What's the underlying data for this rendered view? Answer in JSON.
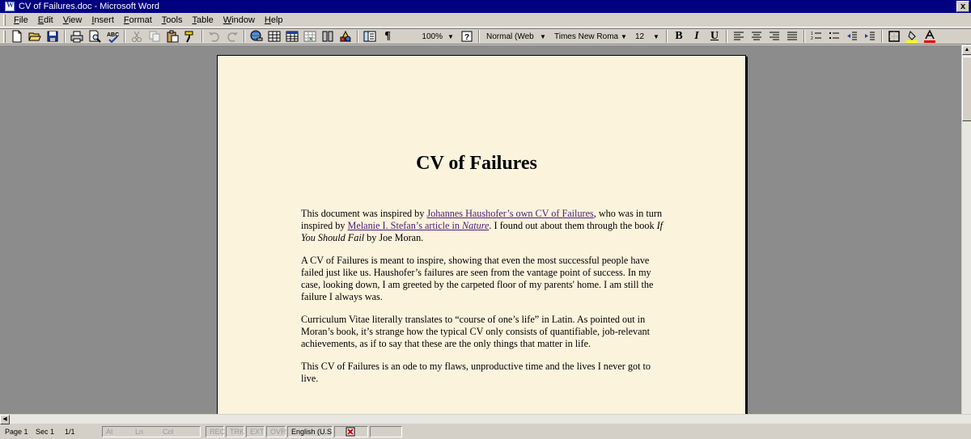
{
  "window": {
    "title": "CV of Failures.doc - Microsoft Word",
    "close_glyph": "x"
  },
  "menu": [
    {
      "ul": "F",
      "rest": "ile"
    },
    {
      "ul": "E",
      "rest": "dit"
    },
    {
      "ul": "V",
      "rest": "iew"
    },
    {
      "ul": "I",
      "rest": "nsert"
    },
    {
      "ul": "F",
      "rest": "ormat"
    },
    {
      "ul": "T",
      "rest": "ools"
    },
    {
      "ul": "T",
      "rest": "able"
    },
    {
      "ul": "W",
      "rest": "indow"
    },
    {
      "ul": "H",
      "rest": "elp"
    }
  ],
  "toolbar": {
    "zoom": "100%",
    "style": "Normal (Web",
    "font": "Times New Roma",
    "size": "12",
    "bold": "B",
    "italic": "I",
    "underline": "U",
    "pilcrow": "¶",
    "help": "?",
    "font_color": "#e00000",
    "highlight_color": "#ffff00"
  },
  "document": {
    "title": "CV of Failures",
    "p1": {
      "t1": "This document was inspired by ",
      "link1": "Johannes Haushofer’s own CV of Failures",
      "t2": ", who was in turn inspired by ",
      "link2a": "Melanie I. Stefan’s article in ",
      "link2b": "Nature",
      "t3": ". I found out about them through the book ",
      "book": "If You Should Fail",
      "t4": " by Joe Moran."
    },
    "p2": "A CV of Failures is meant to inspire, showing that even the most successful people have failed just like us. Haushofer’s failures are seen from the vantage point of success. In my case, looking down, I am greeted by the carpeted floor of my parents' home. I am still the failure I always was.",
    "p3": "Curriculum Vitae literally translates to “course of one’s life” in Latin. As pointed out in Moran’s book, it’s strange how the typical CV only consists of quantifiable, job-relevant achievements, as if to say that these are the only things that matter in life.",
    "p4": "This CV of Failures is an ode to my flaws, unproductive time and the lives I never got to live."
  },
  "status": {
    "page": "Page 1",
    "sec": "Sec 1",
    "pages": "1/1",
    "at": "At",
    "ln": "Ln",
    "col": "Col",
    "rec": "REC",
    "trk": "TRK",
    "ext": "EXT",
    "ovr": "OVR",
    "lang": "English (U.S"
  }
}
